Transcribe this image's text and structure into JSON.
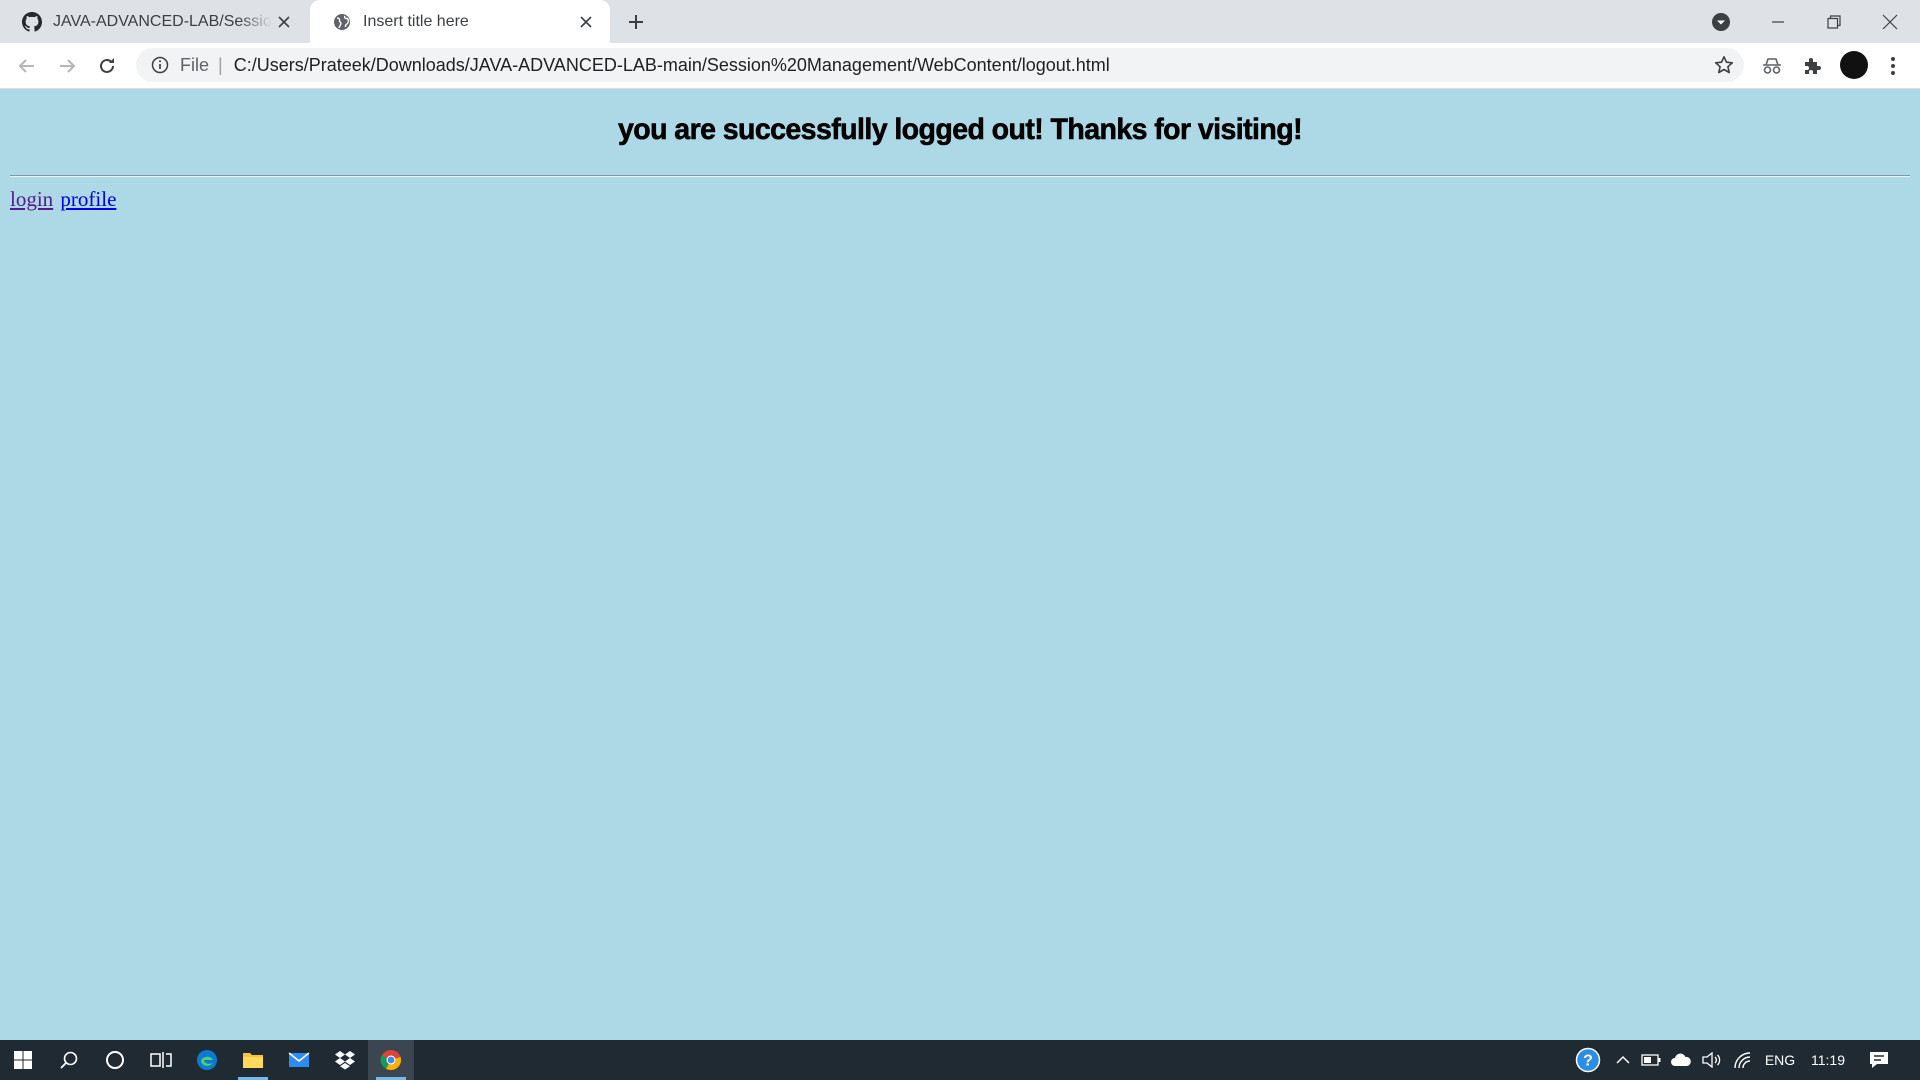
{
  "browser": {
    "tabs": [
      {
        "title": "JAVA-ADVANCED-LAB/Session Management",
        "favicon": "github-icon",
        "active": false
      },
      {
        "title": "Insert title here",
        "favicon": "globe-icon",
        "active": true
      }
    ],
    "address": {
      "scheme": "File",
      "url": "C:/Users/Prateek/Downloads/JAVA-ADVANCED-LAB-main/Session%20Management/WebContent/logout.html"
    }
  },
  "page": {
    "headline": "you are successfully logged out! Thanks for visiting!",
    "links": [
      {
        "label": "login"
      },
      {
        "label": "profile"
      }
    ],
    "background_color": "#add8e6"
  },
  "taskbar": {
    "language": "ENG",
    "time": "11:19"
  }
}
